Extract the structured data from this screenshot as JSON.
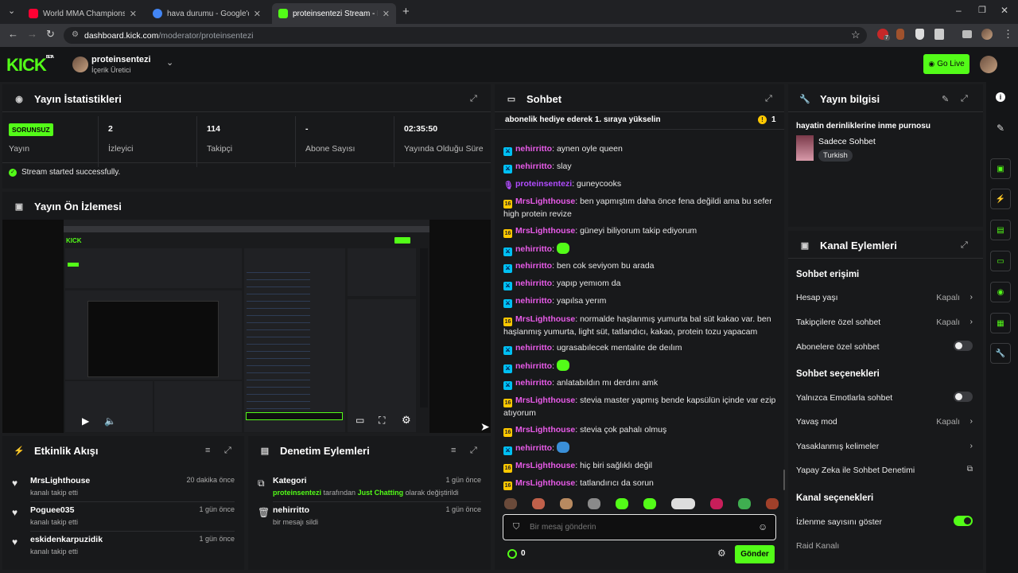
{
  "browser": {
    "tabs": [
      {
        "label": "World MMA Championship Ant",
        "fav_color": "#ff0033"
      },
      {
        "label": "hava durumu - Google'da Ara",
        "fav_color": "#4285f4"
      },
      {
        "label": "proteinsentezi Stream - Kick Da",
        "fav_color": "#53fc18"
      }
    ],
    "url_host": "dashboard.kick.com",
    "url_path": "/moderator/proteinsentezi",
    "ext_badge": "7"
  },
  "header": {
    "logo": "KICK",
    "logo_sup": "BETA",
    "username": "proteinsentezi",
    "role": "İçerik Üretici",
    "go_live": "Go Live"
  },
  "stats": {
    "title": "Yayın İstatistikleri",
    "status_badge": "SORUNSUZ",
    "items": [
      {
        "value": "",
        "label": "Yayın"
      },
      {
        "value": "2",
        "label": "İzleyici"
      },
      {
        "value": "114",
        "label": "Takipçi"
      },
      {
        "value": "-",
        "label": "Abone Sayısı"
      },
      {
        "value": "02:35:50",
        "label": "Yayında Olduğu Süre"
      }
    ],
    "notice": "Stream started successfully."
  },
  "preview": {
    "title": "Yayın Ön İzlemesi"
  },
  "activity": {
    "title": "Etkinlik Akışı",
    "items": [
      {
        "name": "MrsLighthouse",
        "sub": "kanalı takip etti",
        "time": "20 dakika önce"
      },
      {
        "name": "Poguee035",
        "sub": "kanalı takip etti",
        "time": "1 gün önce"
      },
      {
        "name": "eskidenkarpuzidik",
        "sub": "kanalı takip etti",
        "time": "1 gün önce"
      }
    ]
  },
  "moderation": {
    "title": "Denetim Eylemleri",
    "items": [
      {
        "name": "Kategori",
        "sub_user": "proteinsentezi",
        "sub_mid": " tarafından ",
        "sub_cat": "Just Chatting",
        "sub_end": " olarak değiştirildi",
        "time": "1 gün önce"
      },
      {
        "name": "nehirritto",
        "sub_user": "",
        "sub_mid": "bir mesajı sildi",
        "sub_cat": "",
        "sub_end": "",
        "time": "1 gün önce"
      }
    ]
  },
  "chat": {
    "title": "Sohbet",
    "pinned": "abonelik hediye ederek 1. sıraya yükselin",
    "pinned_count": "1",
    "messages": [
      {
        "badge": "mod",
        "user": "nehirritto",
        "color": "#e85be8",
        "text": "aynen oyle queen"
      },
      {
        "badge": "mod",
        "user": "nehirritto",
        "color": "#e85be8",
        "text": "slay"
      },
      {
        "badge": "mic",
        "user": "proteinsentezi",
        "color": "#b14cff",
        "text": "guneycooks"
      },
      {
        "badge": "sub",
        "user": "MrsLighthouse",
        "color": "#e85be8",
        "text": "ben yapmıştım daha önce fena değildi ama bu sefer high protein revize"
      },
      {
        "badge": "sub",
        "user": "MrsLighthouse",
        "color": "#e85be8",
        "text": "güneyi biliyorum takip ediyorum"
      },
      {
        "badge": "mod",
        "user": "nehirritto",
        "color": "#e85be8",
        "text": ""
      },
      {
        "badge": "mod",
        "user": "nehirritto",
        "color": "#e85be8",
        "text": "ben cok seviyom bu arada"
      },
      {
        "badge": "mod",
        "user": "nehirritto",
        "color": "#e85be8",
        "text": "yapıp yemıom da"
      },
      {
        "badge": "mod",
        "user": "nehirritto",
        "color": "#e85be8",
        "text": "yapılsa yerım"
      },
      {
        "badge": "sub",
        "user": "MrsLighthouse",
        "color": "#e85be8",
        "text": "normalde haşlanmış yumurta bal süt kakao var. ben haşlanmış yumurta, light süt, tatlandıcı, kakao, protein tozu yapacam"
      },
      {
        "badge": "mod",
        "user": "nehirritto",
        "color": "#e85be8",
        "text": "ugrasabılecek mentalıte de deılım"
      },
      {
        "badge": "mod",
        "user": "nehirritto",
        "color": "#e85be8",
        "text": ""
      },
      {
        "badge": "mod",
        "user": "nehirritto",
        "color": "#e85be8",
        "text": "anlatabıldın mı derdını amk"
      },
      {
        "badge": "sub",
        "user": "MrsLighthouse",
        "color": "#e85be8",
        "text": "stevia master yapmış bende kapsülün içinde var ezip atıyorum"
      },
      {
        "badge": "sub",
        "user": "MrsLighthouse",
        "color": "#e85be8",
        "text": "stevia çok pahalı olmuş"
      },
      {
        "badge": "mod",
        "user": "nehirritto",
        "color": "#e85be8",
        "text": ""
      },
      {
        "badge": "sub",
        "user": "MrsLighthouse",
        "color": "#e85be8",
        "text": "hiç biri sağlıklı değil"
      },
      {
        "badge": "sub",
        "user": "MrsLighthouse",
        "color": "#e85be8",
        "text": "tatlandırıcı da sorun"
      }
    ],
    "input_placeholder": "Bir mesaj gönderin",
    "points": "0",
    "send": "Gönder"
  },
  "streaminfo": {
    "title": "Yayın bilgisi",
    "stream_title": "hayatin derinliklerine inme purnosu",
    "category": "Sadece Sohbet",
    "language": "Turkish"
  },
  "channel": {
    "title": "Kanal Eylemleri",
    "sections": [
      {
        "heading": "Sohbet erişimi",
        "rows": [
          {
            "label": "Hesap yaşı",
            "value": "Kapalı",
            "kind": "chev"
          },
          {
            "label": "Takipçilere özel sohbet",
            "value": "Kapalı",
            "kind": "chev"
          },
          {
            "label": "Abonelere özel sohbet",
            "value": "",
            "kind": "toggle-off"
          }
        ]
      },
      {
        "heading": "Sohbet seçenekleri",
        "rows": [
          {
            "label": "Yalnızca Emotlarla sohbet",
            "value": "",
            "kind": "toggle-off"
          },
          {
            "label": "Yavaş mod",
            "value": "Kapalı",
            "kind": "chev"
          },
          {
            "label": "Yasaklanmış kelimeler",
            "value": "",
            "kind": "chev"
          },
          {
            "label": "Yapay Zeka ile Sohbet Denetimi",
            "value": "",
            "kind": "ext"
          }
        ]
      },
      {
        "heading": "Kanal seçenekleri",
        "rows": [
          {
            "label": "İzlenme sayısını göster",
            "value": "",
            "kind": "toggle-on"
          },
          {
            "label": "Raid Kanalı",
            "value": "",
            "kind": "none"
          }
        ]
      }
    ]
  },
  "colors": {
    "accent": "#53fc18",
    "panel": "#18191b",
    "bg": "#1c1d1f"
  }
}
